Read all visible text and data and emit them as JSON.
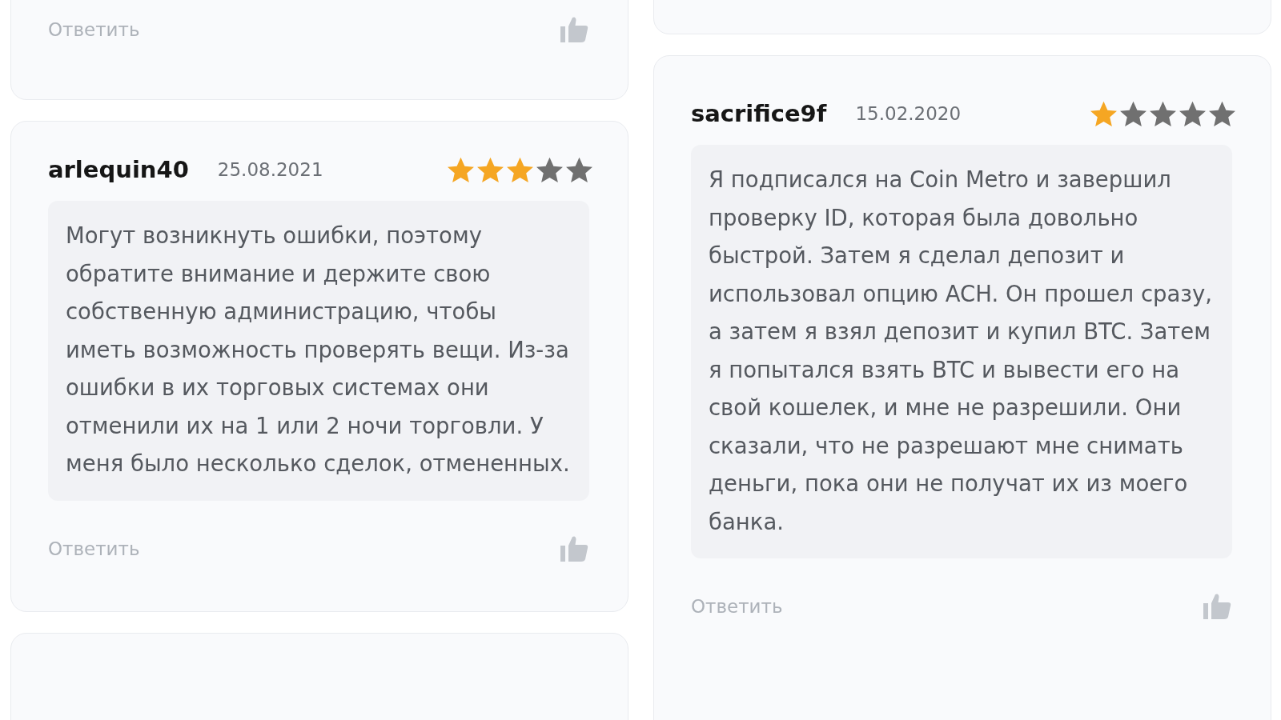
{
  "columns": [
    {
      "reviews": [
        {
          "kind": "partial",
          "reply_label": "Ответить"
        },
        {
          "kind": "full",
          "author": "arlequin40",
          "date": "25.08.2021",
          "stars": 3,
          "text": "Могут возникнуть ошибки, поэтому обратите внимание и держите свою собственную администрацию, чтобы иметь возможность проверять вещи. Из-за ошибки в их торговых системах они отменили их на 1 или 2 ночи торговли. У меня было несколько сделок, отмененных.",
          "reply_label": "Ответить"
        },
        {
          "kind": "edge"
        }
      ]
    },
    {
      "reviews": [
        {
          "kind": "edge"
        },
        {
          "kind": "full",
          "author": "sacrifice9f",
          "date": "15.02.2020",
          "stars": 1,
          "text": "Я подписался на Coin Metro и завершил проверку ID, которая была довольно быстрой. Затем я сделал депозит и использовал опцию ACH. Он прошел сразу, а затем я взял депозит и купил BTC. Затем я попытался взять BTC и вывести его на свой кошелек, и мне не разрешили. Они сказали, что не разрешают мне снимать деньги, пока они не получат их из моего банка.",
          "reply_label": "Ответить"
        }
      ]
    }
  ]
}
